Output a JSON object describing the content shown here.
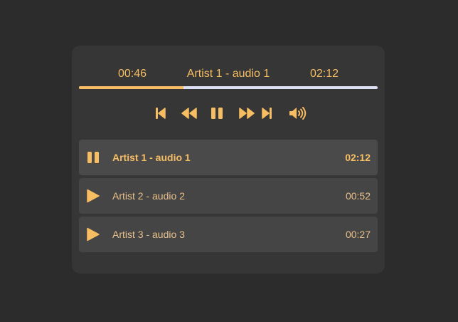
{
  "player": {
    "elapsed": "00:46",
    "title": "Artist 1 - audio 1",
    "duration": "02:12",
    "progress_fraction": 0.35,
    "accent_color": "#f7bd62",
    "track_bg_color": "#dde0f5"
  },
  "controls": [
    {
      "icon": "skip-previous-icon"
    },
    {
      "icon": "rewind-icon"
    },
    {
      "icon": "pause-icon"
    },
    {
      "icon": "fast-forward-icon"
    },
    {
      "icon": "skip-next-icon"
    },
    {
      "icon": "volume-icon"
    }
  ],
  "playlist": [
    {
      "name": "Artist 1 - audio 1",
      "time": "02:12",
      "state_icon": "pause-icon",
      "active": true
    },
    {
      "name": "Artist 2 - audio 2",
      "time": "00:52",
      "state_icon": "play-icon",
      "active": false
    },
    {
      "name": "Artist 3 - audio 3",
      "time": "00:27",
      "state_icon": "play-icon",
      "active": false
    }
  ]
}
